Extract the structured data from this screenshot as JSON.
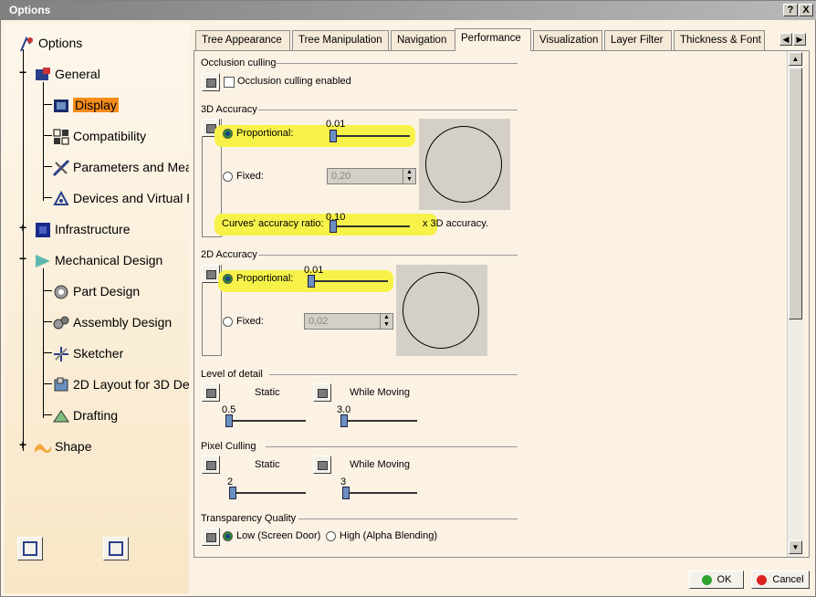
{
  "window": {
    "title": "Options",
    "help_btn": "?",
    "close_btn": "X"
  },
  "tree": {
    "root": "Options",
    "items": [
      {
        "label": "General",
        "icon": "general-icon"
      },
      {
        "label": "Display",
        "icon": "display-icon",
        "selected": true
      },
      {
        "label": "Compatibility",
        "icon": "compatibility-icon"
      },
      {
        "label": "Parameters and Meas",
        "icon": "parameters-icon"
      },
      {
        "label": "Devices and Virtual R",
        "icon": "devices-icon"
      },
      {
        "label": "Infrastructure",
        "icon": "infrastructure-icon"
      },
      {
        "label": "Mechanical Design",
        "icon": "mechanical-icon"
      },
      {
        "label": "Part Design",
        "icon": "part-design-icon"
      },
      {
        "label": "Assembly Design",
        "icon": "assembly-icon"
      },
      {
        "label": "Sketcher",
        "icon": "sketcher-icon"
      },
      {
        "label": "2D Layout for 3D De",
        "icon": "layout-icon"
      },
      {
        "label": "Drafting",
        "icon": "drafting-icon"
      },
      {
        "label": "Shape",
        "icon": "shape-icon"
      }
    ]
  },
  "tabs": [
    "Tree Appearance",
    "Tree Manipulation",
    "Navigation",
    "Performance",
    "Visualization",
    "Layer Filter",
    "Thickness & Font"
  ],
  "active_tab": "Performance",
  "occlusion": {
    "title": "Occlusion culling",
    "checkbox_label": "Occlusion culling enabled",
    "checked": false
  },
  "acc3d": {
    "title": "3D Accuracy",
    "proportional_label": "Proportional:",
    "proportional_value": "0.01",
    "fixed_label": "Fixed:",
    "fixed_value": "0,20",
    "curves_label": "Curves' accuracy ratio:",
    "curves_value": "0.10",
    "curves_suffix": "x 3D accuracy."
  },
  "acc2d": {
    "title": "2D Accuracy",
    "proportional_label": "Proportional:",
    "proportional_value": "0.01",
    "fixed_label": "Fixed:",
    "fixed_value": "0,02"
  },
  "lod": {
    "title": "Level of detail",
    "static_label": "Static",
    "moving_label": "While Moving",
    "static_value": "0.5",
    "moving_value": "3.0"
  },
  "pixel": {
    "title": "Pixel Culling",
    "static_label": "Static",
    "moving_label": "While Moving",
    "static_value": "2",
    "moving_value": "3"
  },
  "transparency": {
    "title": "Transparency Quality",
    "low_label": "Low (Screen Door)",
    "high_label": "High (Alpha Blending)",
    "selected": "low"
  },
  "buttons": {
    "ok": "OK",
    "cancel": "Cancel"
  },
  "colors": {
    "highlight": "#f6f24a",
    "selected_tree": "#f78d1b",
    "ok_dot": "#2fa32f",
    "cancel_dot": "#d22"
  }
}
